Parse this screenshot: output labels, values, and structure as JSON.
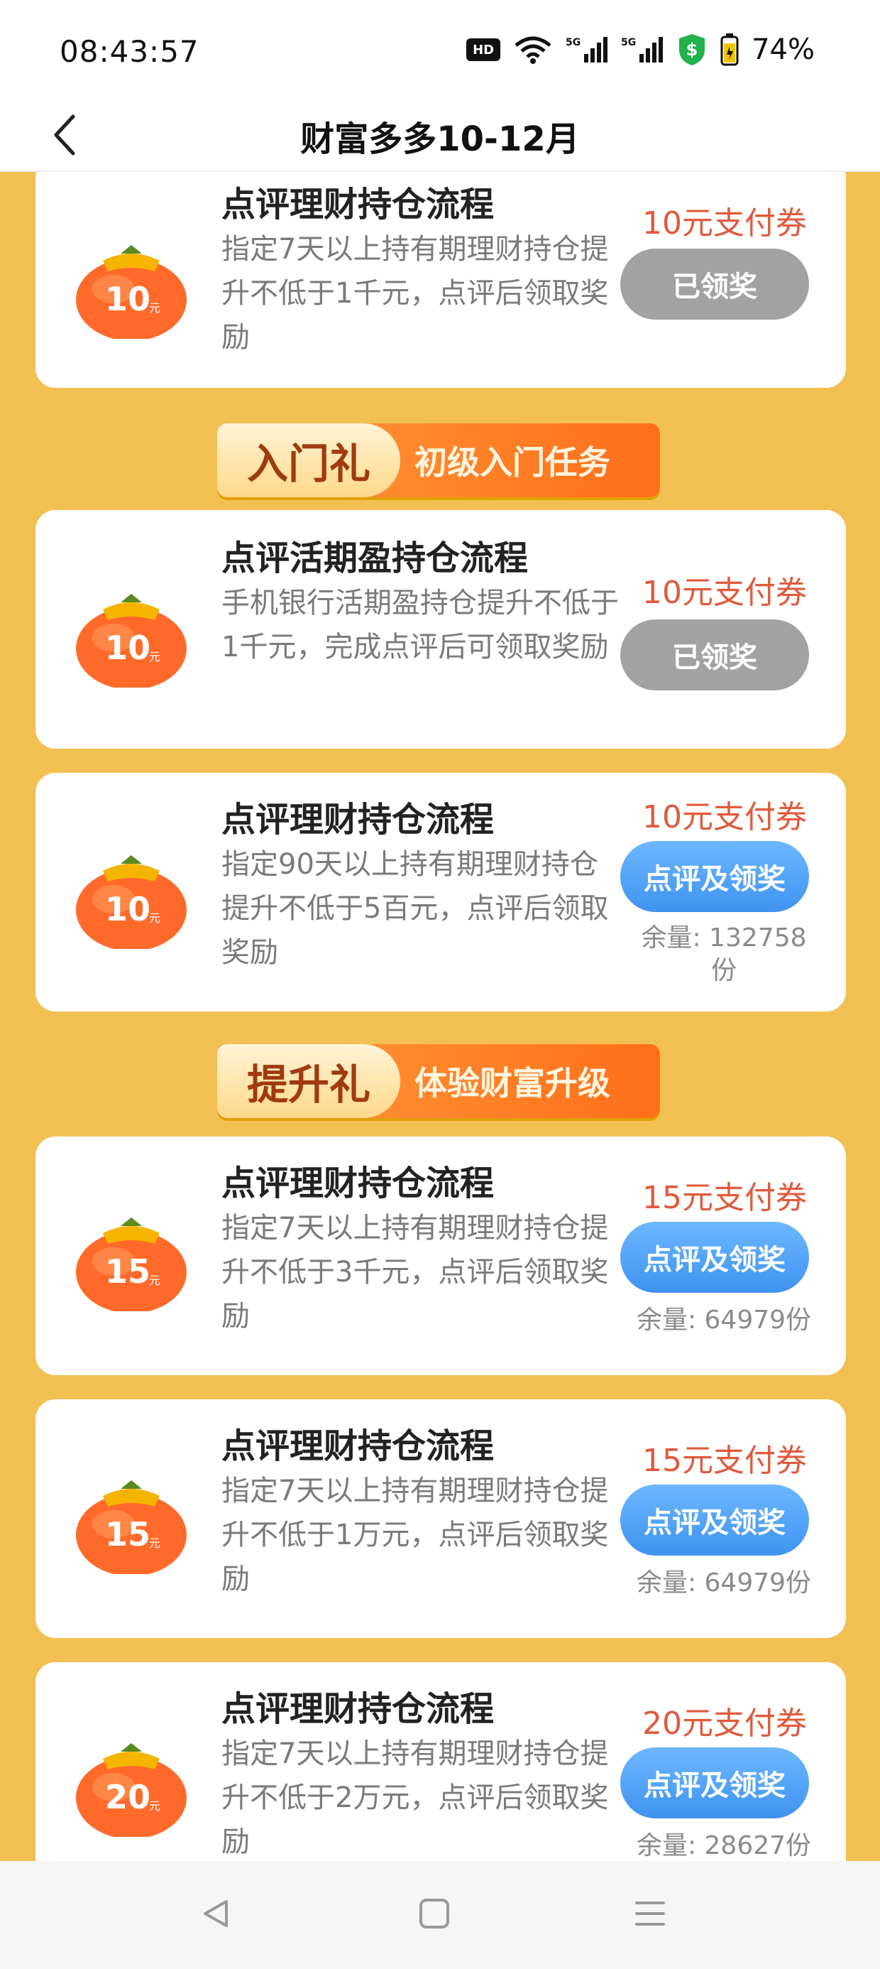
{
  "status": {
    "time": "08:43:57",
    "hd_label": "HD",
    "battery_percent": "74%",
    "icons": [
      "hd-voice-icon",
      "wifi-icon",
      "signal-5g-icon",
      "signal-5g-icon",
      "shield-dollar-icon",
      "battery-icon"
    ]
  },
  "header": {
    "title": "财富多多10-12月",
    "back_icon": "chevron-left-icon"
  },
  "sections": [
    {
      "banner_left": "入门礼",
      "banner_right": "初级入门任务"
    },
    {
      "banner_left": "提升礼",
      "banner_right": "体验财富升级"
    }
  ],
  "cards": [
    {
      "amount": "10",
      "title": "点评理财持仓流程",
      "desc": "指定7天以上持有期理财持仓提升不低于1千元，点评后领取奖励",
      "reward": "10元支付券",
      "button": "已领奖",
      "button_state": "claimed",
      "remain": ""
    },
    {
      "amount": "10",
      "title": "点评活期盈持仓流程",
      "desc": "手机银行活期盈持仓提升不低于1千元，完成点评后可领取奖励",
      "reward": "10元支付券",
      "button": "已领奖",
      "button_state": "claimed",
      "remain": ""
    },
    {
      "amount": "10",
      "title": "点评理财持仓流程",
      "desc": "指定90天以上持有期理财持仓提升不低于5百元，点评后领取奖励",
      "reward": "10元支付券",
      "button": "点评及领奖",
      "button_state": "active",
      "remain": "余量: 132758份"
    },
    {
      "amount": "15",
      "title": "点评理财持仓流程",
      "desc": "指定7天以上持有期理财持仓提升不低于3千元，点评后领取奖励",
      "reward": "15元支付券",
      "button": "点评及领奖",
      "button_state": "active",
      "remain": "余量: 64979份"
    },
    {
      "amount": "15",
      "title": "点评理财持仓流程",
      "desc": "指定7天以上持有期理财持仓提升不低于1万元，点评后领取奖励",
      "reward": "15元支付券",
      "button": "点评及领奖",
      "button_state": "active",
      "remain": "余量: 64979份"
    },
    {
      "amount": "20",
      "title": "点评理财持仓流程",
      "desc": "指定7天以上持有期理财持仓提升不低于2万元，点评后领取奖励",
      "reward": "20元支付券",
      "button": "点评及领奖",
      "button_state": "active",
      "remain": "余量: 28627份"
    }
  ],
  "colors": {
    "page_background": "#f2c052",
    "reward_text": "#e05a3c",
    "button_active": "#4a9cf2",
    "button_claimed": "#a2a2a2",
    "banner_orange": "#ff7a22"
  },
  "bottom_nav": [
    "back-triangle-icon",
    "home-square-icon",
    "menu-lines-icon"
  ]
}
